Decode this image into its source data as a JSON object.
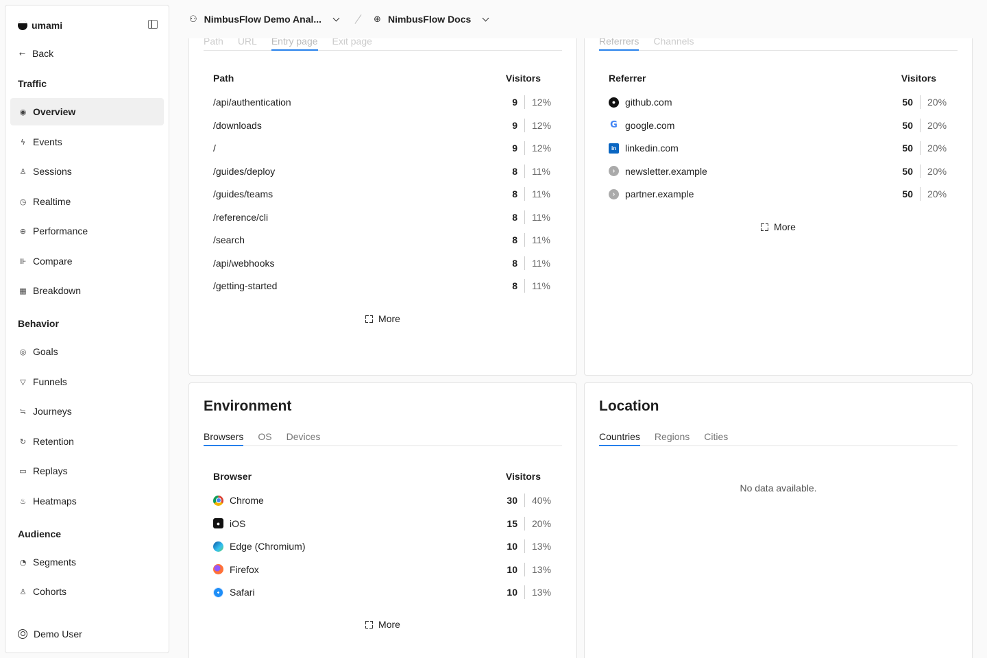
{
  "app": {
    "name": "umami"
  },
  "sidebar": {
    "back_label": "Back",
    "sections": {
      "traffic": "Traffic",
      "behavior": "Behavior",
      "audience": "Audience"
    },
    "items": {
      "overview": "Overview",
      "events": "Events",
      "sessions": "Sessions",
      "realtime": "Realtime",
      "performance": "Performance",
      "compare": "Compare",
      "breakdown": "Breakdown",
      "goals": "Goals",
      "funnels": "Funnels",
      "journeys": "Journeys",
      "retention": "Retention",
      "replays": "Replays",
      "heatmaps": "Heatmaps",
      "segments": "Segments",
      "cohorts": "Cohorts"
    },
    "active": "Overview",
    "user": "Demo User"
  },
  "header": {
    "team": "NimbusFlow Demo Anal...",
    "website": "NimbusFlow Docs"
  },
  "pages_panel": {
    "tabs": [
      "Path",
      "URL",
      "Entry page",
      "Exit page"
    ],
    "active_tab": "Entry page",
    "col_label": "Path",
    "col_value": "Visitors",
    "rows": [
      {
        "label": "/api/authentication",
        "count": "9",
        "pct": "12%"
      },
      {
        "label": "/downloads",
        "count": "9",
        "pct": "12%"
      },
      {
        "label": "/",
        "count": "9",
        "pct": "12%"
      },
      {
        "label": "/guides/deploy",
        "count": "8",
        "pct": "11%"
      },
      {
        "label": "/guides/teams",
        "count": "8",
        "pct": "11%"
      },
      {
        "label": "/reference/cli",
        "count": "8",
        "pct": "11%"
      },
      {
        "label": "/search",
        "count": "8",
        "pct": "11%"
      },
      {
        "label": "/api/webhooks",
        "count": "8",
        "pct": "11%"
      },
      {
        "label": "/getting-started",
        "count": "8",
        "pct": "11%"
      }
    ],
    "more": "More"
  },
  "sources_panel": {
    "tabs": [
      "Referrers",
      "Channels"
    ],
    "active_tab": "Referrers",
    "col_label": "Referrer",
    "col_value": "Visitors",
    "rows": [
      {
        "label": "github.com",
        "icon": "github-icon",
        "count": "50",
        "pct": "20%"
      },
      {
        "label": "google.com",
        "icon": "google-icon",
        "count": "50",
        "pct": "20%"
      },
      {
        "label": "linkedin.com",
        "icon": "linkedin-icon",
        "count": "50",
        "pct": "20%"
      },
      {
        "label": "newsletter.example",
        "icon": "link-icon",
        "count": "50",
        "pct": "20%"
      },
      {
        "label": "partner.example",
        "icon": "link-icon",
        "count": "50",
        "pct": "20%"
      }
    ],
    "more": "More"
  },
  "environment_panel": {
    "title": "Environment",
    "tabs": [
      "Browsers",
      "OS",
      "Devices"
    ],
    "active_tab": "Browsers",
    "col_label": "Browser",
    "col_value": "Visitors",
    "rows": [
      {
        "label": "Chrome",
        "icon": "chrome-icon",
        "count": "30",
        "pct": "40%"
      },
      {
        "label": "iOS",
        "icon": "ios-icon",
        "count": "15",
        "pct": "20%"
      },
      {
        "label": "Edge (Chromium)",
        "icon": "edge-icon",
        "count": "10",
        "pct": "13%"
      },
      {
        "label": "Firefox",
        "icon": "firefox-icon",
        "count": "10",
        "pct": "13%"
      },
      {
        "label": "Safari",
        "icon": "safari-icon",
        "count": "10",
        "pct": "13%"
      }
    ],
    "more": "More"
  },
  "location_panel": {
    "title": "Location",
    "tabs": [
      "Countries",
      "Regions",
      "Cities"
    ],
    "active_tab": "Countries",
    "empty": "No data available."
  },
  "colors": {
    "accent": "#2680eb",
    "active_bg": "#f0f0f0"
  }
}
